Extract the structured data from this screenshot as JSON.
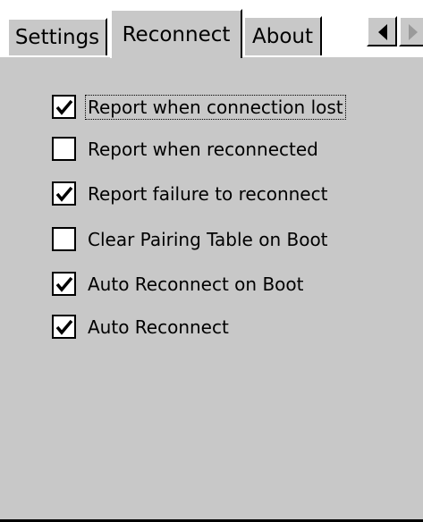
{
  "tabs": [
    {
      "label": "Settings",
      "active": false
    },
    {
      "label": "Reconnect",
      "active": true
    },
    {
      "label": "About",
      "active": false
    }
  ],
  "scroll": {
    "left_icon": "left-arrow-icon",
    "right_icon": "right-arrow-icon"
  },
  "options": [
    {
      "label": "Report when connection lost",
      "checked": true,
      "focused": true
    },
    {
      "label": "Report when reconnected",
      "checked": false,
      "focused": false
    },
    {
      "label": "Report failure to reconnect",
      "checked": true,
      "focused": false
    },
    {
      "label": "Clear Pairing Table on Boot",
      "checked": false,
      "focused": false
    },
    {
      "label": "Auto Reconnect on Boot",
      "checked": true,
      "focused": false
    },
    {
      "label": "Auto Reconnect",
      "checked": true,
      "focused": false
    }
  ]
}
